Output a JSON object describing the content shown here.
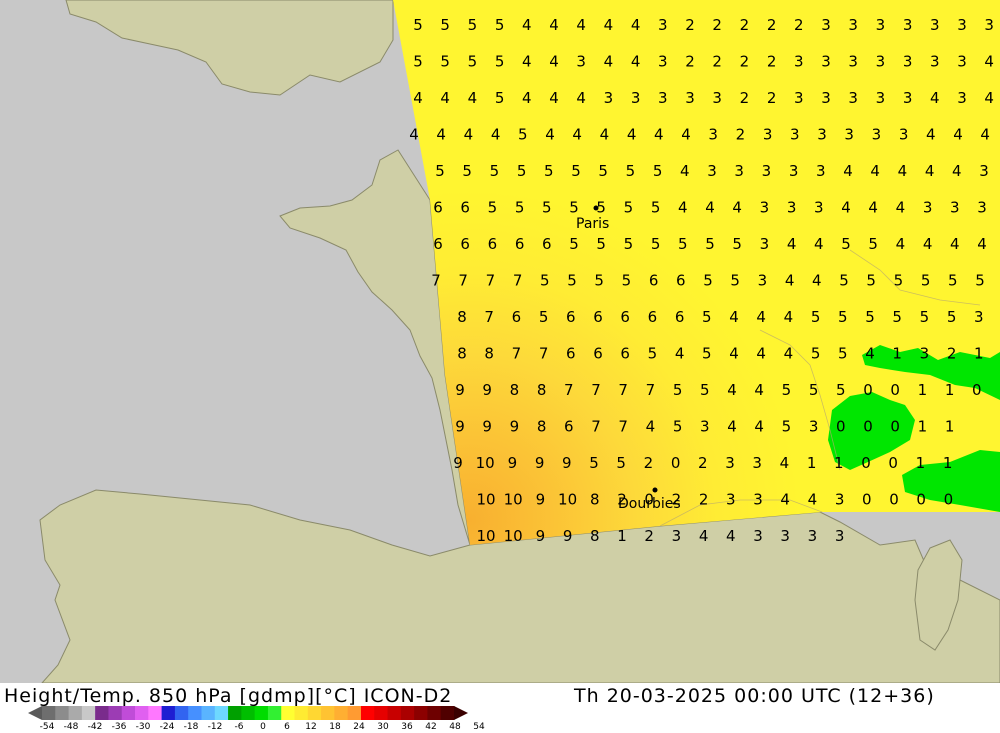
{
  "header": {
    "left": "Height/Temp. 850 hPa [gdmp][°C] ICON-D2",
    "right": "Th 20-03-2025 00:00 UTC (12+36)"
  },
  "colors": {
    "sea": "#c8c8c8",
    "land": "#cfcfa6",
    "domain_cool": "#ffff33",
    "domain_mid": "#ffdd33",
    "domain_warm": "#ffbb33",
    "zero_contour": "#00ee00",
    "coast": "#888888"
  },
  "cities": [
    {
      "name": "Paris"
    },
    {
      "name": "Dourbies"
    }
  ],
  "contour_rows": [
    {
      "values": [
        "5",
        "5",
        "5",
        "5",
        "4",
        "4",
        "4",
        "4",
        "4",
        "3",
        "2",
        "2",
        "2",
        "2",
        "2",
        "3",
        "3",
        "3",
        "3",
        "3",
        "3",
        "3",
        "3"
      ]
    },
    {
      "values": [
        "5",
        "5",
        "5",
        "5",
        "4",
        "4",
        "3",
        "4",
        "4",
        "3",
        "2",
        "2",
        "2",
        "2",
        "3",
        "3",
        "3",
        "3",
        "3",
        "3",
        "3",
        "4",
        "4",
        "3"
      ]
    },
    {
      "values": [
        "4",
        "4",
        "4",
        "5",
        "4",
        "4",
        "4",
        "3",
        "3",
        "3",
        "3",
        "3",
        "2",
        "2",
        "3",
        "3",
        "3",
        "3",
        "3",
        "4",
        "3",
        "4",
        "4"
      ]
    },
    {
      "values": [
        "4",
        "4",
        "4",
        "4",
        "5",
        "4",
        "4",
        "4",
        "4",
        "4",
        "4",
        "3",
        "2",
        "3",
        "3",
        "3",
        "3",
        "3",
        "3",
        "4",
        "4",
        "4",
        "4"
      ]
    },
    {
      "values": [
        "5",
        "5",
        "5",
        "5",
        "5",
        "5",
        "5",
        "5",
        "5",
        "4",
        "3",
        "3",
        "3",
        "3",
        "3",
        "4",
        "4",
        "4",
        "4",
        "4",
        "3",
        "4"
      ]
    },
    {
      "values": [
        "6",
        "6",
        "5",
        "5",
        "5",
        "5",
        "5",
        "5",
        "5",
        "4",
        "4",
        "4",
        "3",
        "3",
        "3",
        "4",
        "4",
        "4",
        "3",
        "3",
        "3",
        "4"
      ]
    },
    {
      "values": [
        "6",
        "6",
        "6",
        "6",
        "6",
        "5",
        "5",
        "5",
        "5",
        "5",
        "5",
        "5",
        "3",
        "4",
        "4",
        "5",
        "5",
        "4",
        "4",
        "4",
        "4",
        "4"
      ]
    },
    {
      "values": [
        "7",
        "7",
        "7",
        "7",
        "5",
        "5",
        "5",
        "5",
        "6",
        "6",
        "5",
        "5",
        "3",
        "4",
        "4",
        "5",
        "5",
        "5",
        "5",
        "5",
        "5",
        "5"
      ]
    },
    {
      "values": [
        "8",
        "7",
        "6",
        "5",
        "6",
        "6",
        "6",
        "6",
        "6",
        "5",
        "4",
        "4",
        "4",
        "5",
        "5",
        "5",
        "5",
        "5",
        "5",
        "3"
      ]
    },
    {
      "values": [
        "8",
        "8",
        "7",
        "7",
        "6",
        "6",
        "6",
        "5",
        "4",
        "5",
        "4",
        "4",
        "4",
        "5",
        "5",
        "4",
        "1",
        "3",
        "2",
        "1"
      ]
    },
    {
      "values": [
        "9",
        "9",
        "8",
        "8",
        "7",
        "7",
        "7",
        "7",
        "5",
        "5",
        "4",
        "4",
        "5",
        "5",
        "5",
        "0",
        "0",
        "1",
        "1",
        "0"
      ]
    },
    {
      "values": [
        "9",
        "9",
        "9",
        "8",
        "6",
        "7",
        "7",
        "4",
        "5",
        "3",
        "4",
        "4",
        "5",
        "3",
        "0",
        "0",
        "0",
        "1",
        "1"
      ]
    },
    {
      "values": [
        "9",
        "10",
        "9",
        "9",
        "9",
        "5",
        "5",
        "2",
        "0",
        "2",
        "3",
        "3",
        "4",
        "1",
        "1",
        "0",
        "0",
        "1",
        "1"
      ]
    },
    {
      "values": [
        "10",
        "10",
        "9",
        "10",
        "8",
        "2",
        "0",
        "2",
        "2",
        "3",
        "3",
        "4",
        "4",
        "3",
        "0",
        "0",
        "0",
        "0"
      ]
    },
    {
      "values": [
        "10",
        "10",
        "9",
        "9",
        "8",
        "1",
        "2",
        "3",
        "4",
        "4",
        "3",
        "3",
        "3",
        "3"
      ]
    }
  ],
  "colorbar": {
    "colors": [
      "#6e6e6e",
      "#8c8c8c",
      "#aaaaaa",
      "#c8c8c8",
      "#7a2c8c",
      "#9c3cb4",
      "#c04cd8",
      "#e060f0",
      "#ff78ff",
      "#1e1ed2",
      "#3264f0",
      "#4690ff",
      "#5ab4ff",
      "#6ed8ff",
      "#00a000",
      "#00be00",
      "#00dc00",
      "#32f032",
      "#ffff32",
      "#ffeb32",
      "#ffd732",
      "#ffc332",
      "#ffaf32",
      "#ff9b32",
      "#ff0000",
      "#e60000",
      "#c80000",
      "#aa0000",
      "#8c0000",
      "#6e0000",
      "#500000"
    ],
    "ticks": [
      "-54",
      "-48",
      "-42",
      "-36",
      "-30",
      "-24",
      "-18",
      "-12",
      "-6",
      "0",
      "6",
      "12",
      "18",
      "24",
      "30",
      "36",
      "42",
      "48",
      "54"
    ]
  }
}
